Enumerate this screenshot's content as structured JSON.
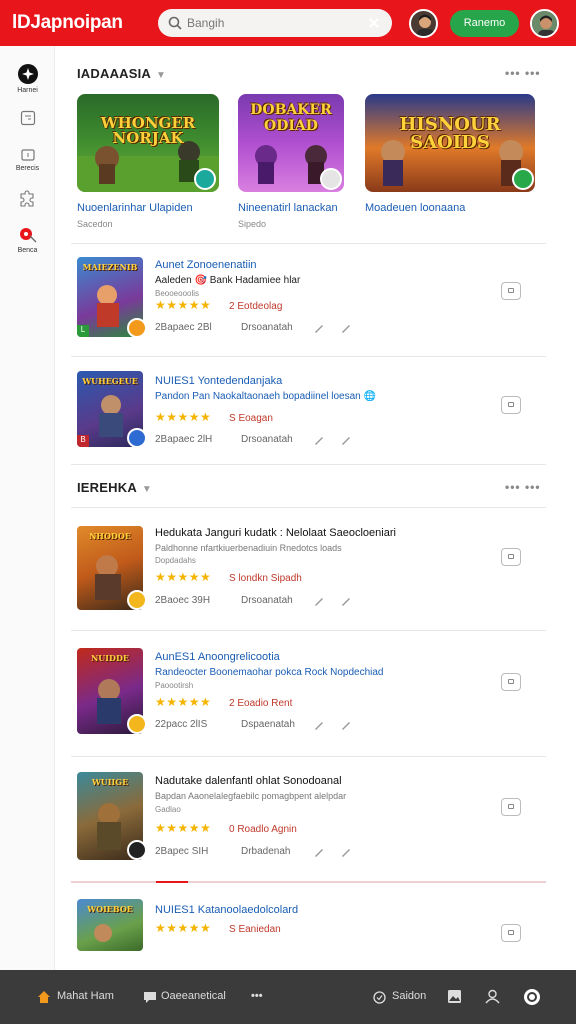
{
  "header": {
    "logo": "lDJapnoipan",
    "search_placeholder": "Bangih",
    "action_button": "Ranemo"
  },
  "sidebar": {
    "items": [
      {
        "label": "Harnei",
        "icon": "compass-icon"
      },
      {
        "label": "",
        "icon": "tablet-icon"
      },
      {
        "label": "Berecis",
        "icon": "bag-icon"
      },
      {
        "label": "",
        "icon": "puzzle-icon"
      },
      {
        "label": "Benca",
        "icon": "tag-icon"
      }
    ]
  },
  "section1": {
    "title": "IADAAASIA",
    "more": "•••  •••",
    "featured": [
      {
        "art_title": "WHONGER NORJAK",
        "name": "Nuoenlarinhar Ulapiden",
        "sub": "Sacedon",
        "badge_color": "#1aa99a"
      },
      {
        "art_title": "DOBAKER ODIAD",
        "name": "Nineenatirl lanackan",
        "sub": "Sipedo",
        "badge_color": "#e5e5e5"
      },
      {
        "art_title": "HISNOUR SAOIDS",
        "name": "Moadeuen loonaana",
        "sub": "",
        "badge_color": "#29a84a"
      }
    ]
  },
  "list1": [
    {
      "title": "Aunet Zonoenenatiin",
      "sub": "Aaleden 🎯 Bank Hadamiee hlar",
      "small": "Beooeooolis",
      "stars": "★★★★★",
      "rating_label": "2 Eotdeolag",
      "meta1": "2Bapaec  2Bl",
      "meta2": "Drsoanatah",
      "thumb_title": "MAIEZENIB",
      "badge_color": "#f39a1d",
      "corner": "L"
    },
    {
      "title": "NUIES1 Yontedendanjaka",
      "sub": "Pandon Pan Naokaltaonaeh bopadiinel loesan 🌐",
      "small": "",
      "stars": "★★★★★",
      "rating_label": "S Eoagan",
      "meta1": "2Bapaec  2lH",
      "meta2": "Drsoanatah",
      "thumb_title": "WUHEGEUE",
      "badge_color": "#2d6ad2",
      "corner": "B"
    }
  ],
  "section2": {
    "title": "IEREHKA",
    "more": "•••  •••"
  },
  "list2": [
    {
      "title": "Hedukata Janguri kudatk : Nelolaat Saeocloeniari",
      "sub": "Paldhonne nfartkiuerbenadiuin Rnedotcs loads",
      "small": "Dopdadahs",
      "stars": "★★★★★",
      "rating_label": "S londkn Sipadh",
      "meta1": "2Baoec  39H",
      "meta2": "Drsoanatah",
      "thumb_title": "NHODOE",
      "badge_color": "#f3b71d"
    },
    {
      "title": "AunES1 Anoongrelicootia",
      "sub": "Randeocter Boonemaohar pokca Rock Nopdechiad",
      "small": "Paoootirsh",
      "stars": "★★★★★",
      "rating_label": "2 Eoadio Rent",
      "meta1": "22pacc  2lIS",
      "meta2": "Dspaenatah",
      "thumb_title": "NUIDDE",
      "badge_color": "#f3b71d"
    },
    {
      "title": "Nadutake dalenfantl ohlat Sonodoanal",
      "sub": "Bapdan  Aaonelalegfaebilc pomagbpent alelpdar",
      "small": "Gadlao",
      "stars": "★★★★★",
      "rating_label": "0 Roadlo Agnin",
      "meta1": "2Bapec  SIH",
      "meta2": "Drbadenah",
      "thumb_title": "WUIIGE",
      "badge_color": "#222222"
    }
  ],
  "list3": [
    {
      "title": "NUIES1 Katanoolaedolcolard",
      "stars": "★★★★★",
      "rating_label": "S Eaniedan",
      "thumb_title": "WOIEBOE"
    }
  ],
  "bottom": {
    "item1": "Mahat Ham",
    "item2": "Oaeeanetical",
    "item3": "•••",
    "item4": "Saidon"
  },
  "colors": {
    "brand_red": "#e8151b",
    "link_blue": "#1a5db4",
    "star": "#f5b400",
    "button_green": "#27a54a"
  }
}
